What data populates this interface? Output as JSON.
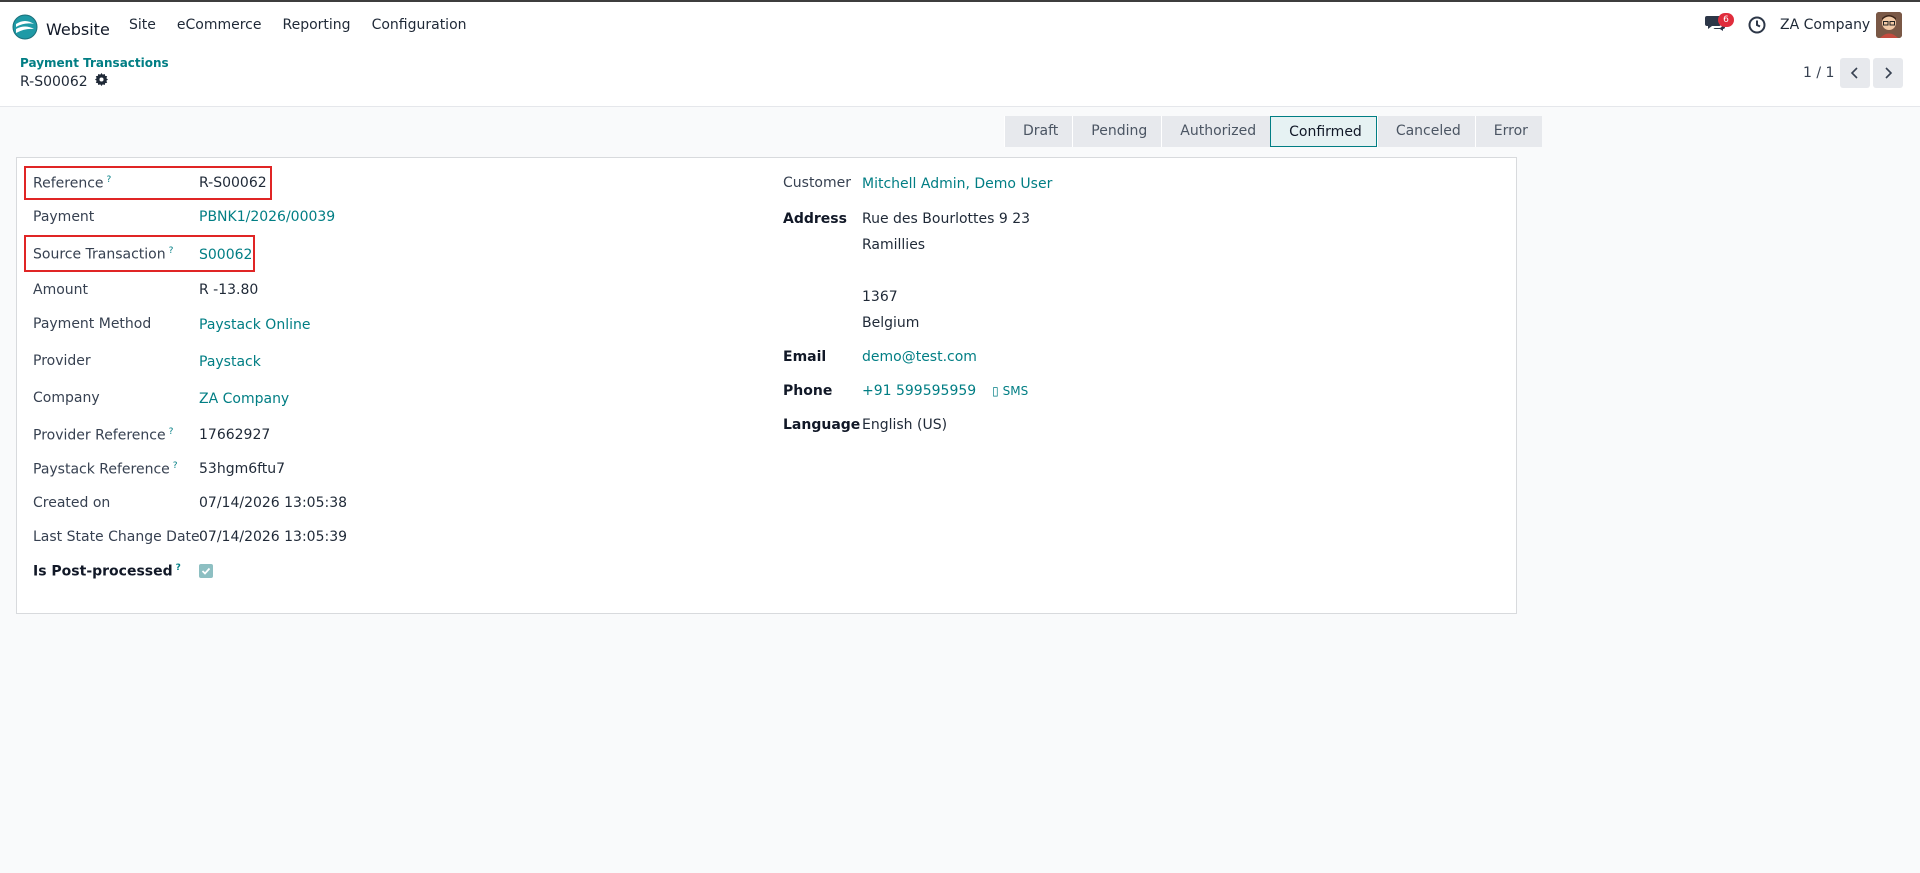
{
  "nav": {
    "app_name": "Website",
    "menu": [
      "Site",
      "eCommerce",
      "Reporting",
      "Configuration"
    ],
    "chat_count": "6",
    "company": "ZA Company"
  },
  "control": {
    "breadcrumb": "Payment Transactions",
    "record": "R-S00062",
    "pager": "1 / 1"
  },
  "stages": {
    "items": [
      "Draft",
      "Pending",
      "Authorized",
      "Confirmed",
      "Canceled",
      "Error"
    ],
    "active": "Confirmed"
  },
  "left_fields": {
    "reference": {
      "label": "Reference",
      "value": "R-S00062"
    },
    "payment": {
      "label": "Payment",
      "value": "PBNK1/2026/00039"
    },
    "source_transaction": {
      "label": "Source Transaction",
      "value": "S00062"
    },
    "amount": {
      "label": "Amount",
      "value": "R -13.80"
    },
    "payment_method": {
      "label": "Payment Method",
      "value": "Paystack Online"
    },
    "provider": {
      "label": "Provider",
      "value": "Paystack"
    },
    "company": {
      "label": "Company",
      "value": "ZA Company"
    },
    "provider_reference": {
      "label": "Provider Reference",
      "value": "17662927"
    },
    "paystack_reference": {
      "label": "Paystack Reference",
      "value": "53hgm6ftu7"
    },
    "created_on": {
      "label": "Created on",
      "value": "07/14/2026 13:05:38"
    },
    "last_state_change": {
      "label": "Last State Change Date",
      "value": "07/14/2026 13:05:39"
    },
    "post_processed": {
      "label": "Is Post-processed",
      "checked": true
    }
  },
  "right_fields": {
    "customer": {
      "label": "Customer",
      "value": "Mitchell Admin, Demo User"
    },
    "address": {
      "label": "Address",
      "line1": "Rue des Bourlottes 9 23",
      "line2": "Ramillies",
      "zip": "1367",
      "country": "Belgium"
    },
    "email": {
      "label": "Email",
      "value": "demo@test.com"
    },
    "phone": {
      "label": "Phone",
      "value": "+91 599595959",
      "sms": "SMS"
    },
    "language": {
      "label": "Language",
      "value": "English (US)"
    }
  },
  "help_mark": "?",
  "colors": {
    "accent": "#017e84",
    "highlight": "#e02525",
    "badge": "#e02d3c"
  }
}
